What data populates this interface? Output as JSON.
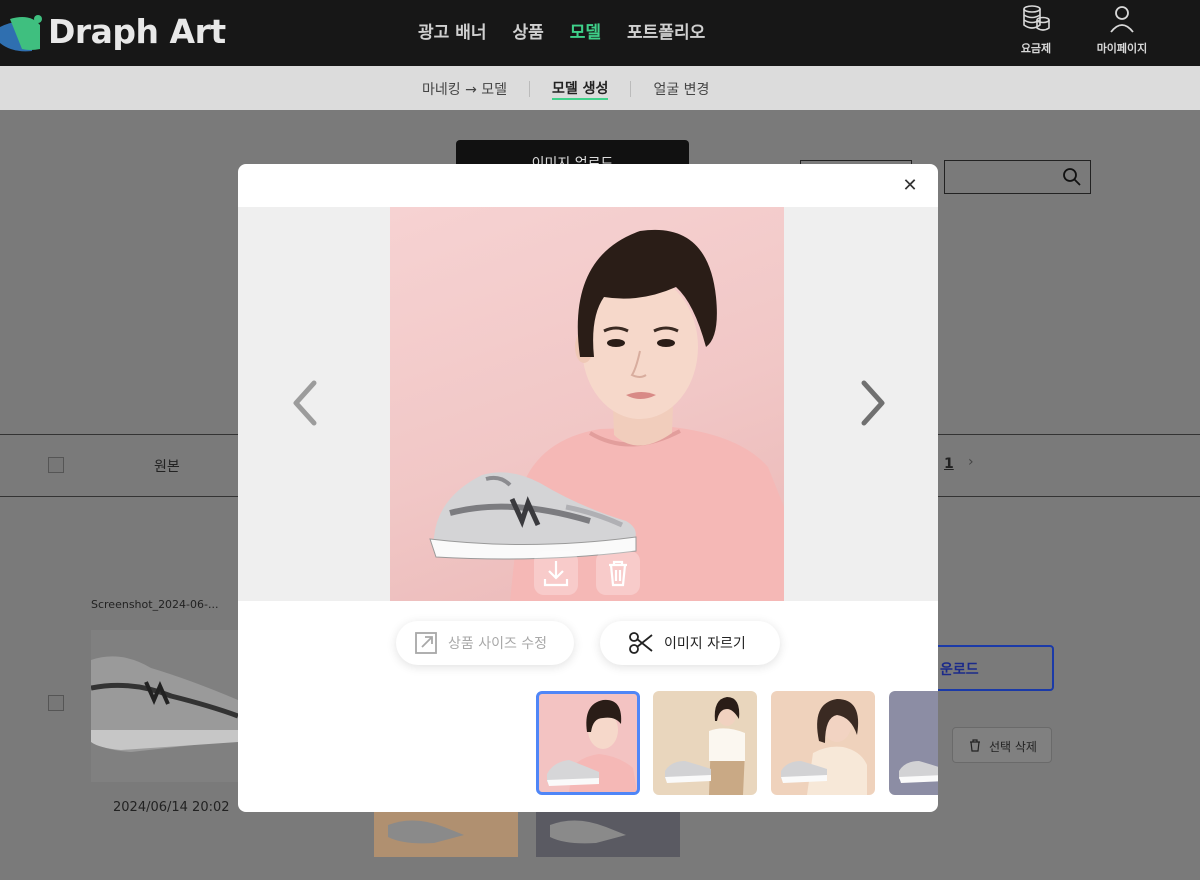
{
  "header": {
    "logo_text": "Draph Art",
    "nav": [
      "광고 배너",
      "상품",
      "모델",
      "포트폴리오"
    ],
    "active_nav_index": 2,
    "pricing_label": "요금제",
    "mypage_label": "마이페이지",
    "accent_color": "#3fd18a"
  },
  "subnav": {
    "items": [
      "마네킹 → 모델",
      "모델 생성",
      "얼굴 변경"
    ],
    "active_index": 1
  },
  "background": {
    "upload_label": "이미지 업로드",
    "column_original": "원본",
    "page_number": "1",
    "file_name": "Screenshot_2024-06-...",
    "date": "2024/06/14 20:02",
    "download_label": "운로드",
    "delete_label": "선택 삭제"
  },
  "modal": {
    "close_icon": "close-icon",
    "resize_label": "상품 사이즈 수정",
    "crop_label": "이미지 자르기",
    "selected_index": 0,
    "thumbnail_count": 4
  }
}
